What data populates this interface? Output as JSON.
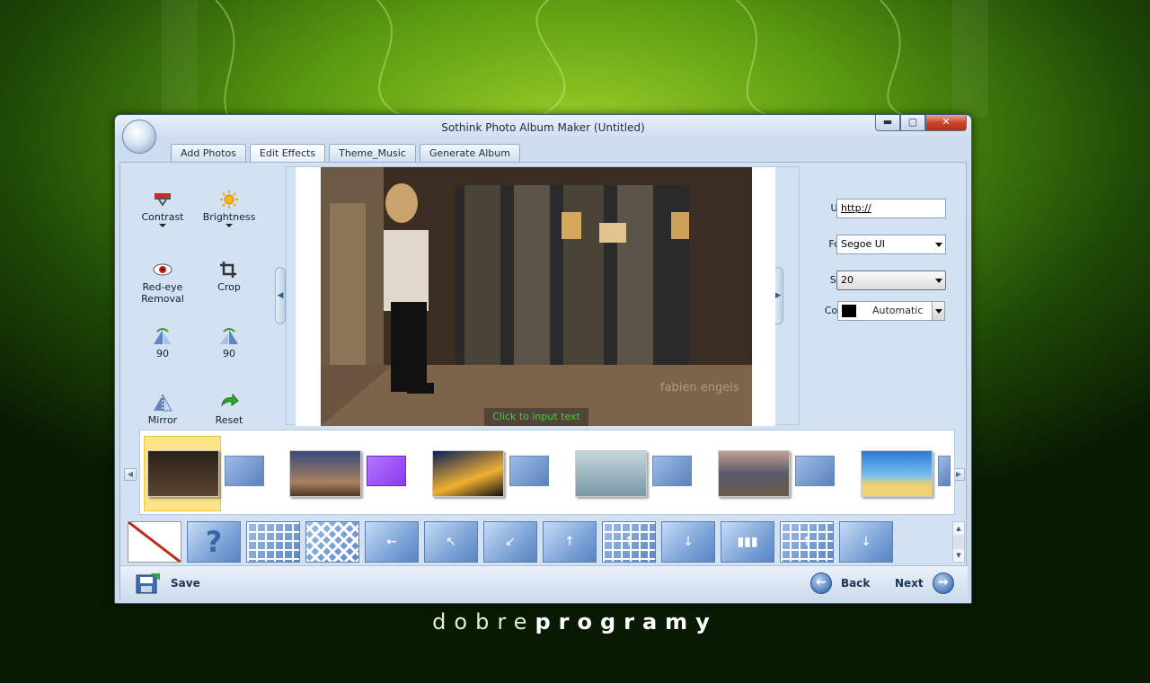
{
  "window": {
    "title": "Sothink Photo Album Maker (Untitled)"
  },
  "window_controls": {
    "minimize": "▬",
    "maximize": "▢",
    "close": "✕"
  },
  "tabs": [
    {
      "label": "Add Photos",
      "active": false
    },
    {
      "label": "Edit Effects",
      "active": true
    },
    {
      "label": "Theme_Music",
      "active": false
    },
    {
      "label": "Generate Album",
      "active": false
    }
  ],
  "tools": [
    {
      "label": "Contrast",
      "icon": "contrast-icon",
      "has_dropdown": true
    },
    {
      "label": "Brightness",
      "icon": "brightness-icon",
      "has_dropdown": true
    },
    {
      "label": "Red-eye Removal",
      "icon": "red-eye-icon"
    },
    {
      "label": "Crop",
      "icon": "crop-icon"
    },
    {
      "label": "90",
      "icon": "rotate-left-icon"
    },
    {
      "label": "90",
      "icon": "rotate-right-icon"
    },
    {
      "label": "Mirror",
      "icon": "mirror-icon"
    },
    {
      "label": "Reset",
      "icon": "reset-icon"
    }
  ],
  "preview": {
    "caption_placeholder": "Click to input text",
    "watermark": "fabien engels"
  },
  "properties": {
    "url_label": "URL:",
    "url_value": "http://",
    "font_label": "Font:",
    "font_value": "Segoe UI",
    "size_label": "Size:",
    "size_value": "20",
    "color_label": "Color:",
    "color_value": "Automatic",
    "color_swatch": "#000000"
  },
  "thumbnails": [
    {
      "name": "photo-woman-doorway",
      "selected": true
    },
    {
      "name": "photo-tree-sunset"
    },
    {
      "name": "photo-night-bridge"
    },
    {
      "name": "photo-winter-branches"
    },
    {
      "name": "photo-railway-tracks"
    },
    {
      "name": "photo-tropical-beach"
    }
  ],
  "bottom": {
    "save_label": "Save",
    "back_label": "Back",
    "next_label": "Next"
  },
  "footer": {
    "logo_light": "dobre",
    "logo_bold": "programy"
  },
  "colors": {
    "accent": "#5884c4",
    "selected": "#fbe38a",
    "caption_text": "#3ad23a"
  }
}
